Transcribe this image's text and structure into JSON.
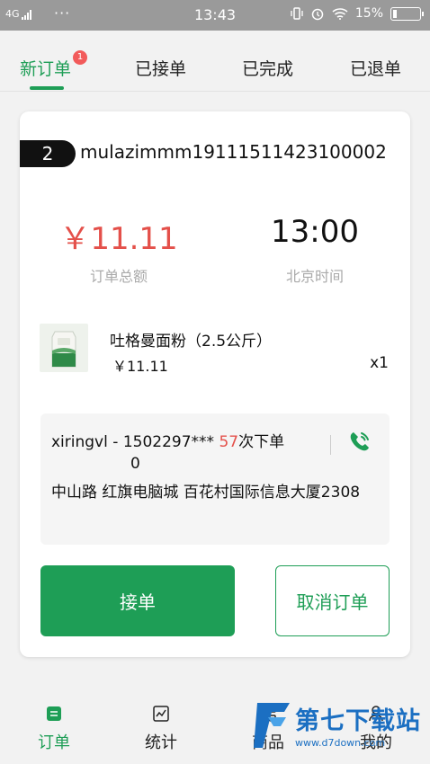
{
  "status_bar": {
    "network": "4G",
    "dots": "···",
    "time": "13:43",
    "battery_pct": "15%",
    "battery_level": 0.15
  },
  "tabs": [
    {
      "label": "新订单",
      "badge": "1",
      "active": true
    },
    {
      "label": "已接单"
    },
    {
      "label": "已完成"
    },
    {
      "label": "已退单"
    }
  ],
  "order": {
    "number": "2",
    "id": "mulazimmm19111511423100002",
    "amount": "￥11.11",
    "amount_label": "订单总额",
    "time": "13:00",
    "time_label": "北京时间",
    "product": {
      "name": "吐格曼面粉（2.5公斤）",
      "price": "￥11.11",
      "qty": "x1"
    },
    "customer": {
      "name": "xiringvl",
      "dash": "-",
      "phone": "1502297***",
      "order_count": "57",
      "order_suffix": "次下单",
      "extra": "0",
      "address": "中山路 红旗电脑城 百花村国际信息大厦2308"
    },
    "accept_label": "接单",
    "cancel_label": "取消订单"
  },
  "bottom_nav": [
    {
      "label": "订单",
      "icon": "order-icon",
      "active": true
    },
    {
      "label": "统计",
      "icon": "stats-icon"
    },
    {
      "label": "商品",
      "icon": "grid-icon"
    },
    {
      "label": "我的",
      "icon": "person-icon"
    }
  ],
  "watermark": {
    "text": "第七下载站",
    "url": "www.d7down.com"
  },
  "colors": {
    "accent": "#1e9e56",
    "price": "#e4504a",
    "badge": "#f25a5a",
    "watermark": "#1b6fc2"
  }
}
